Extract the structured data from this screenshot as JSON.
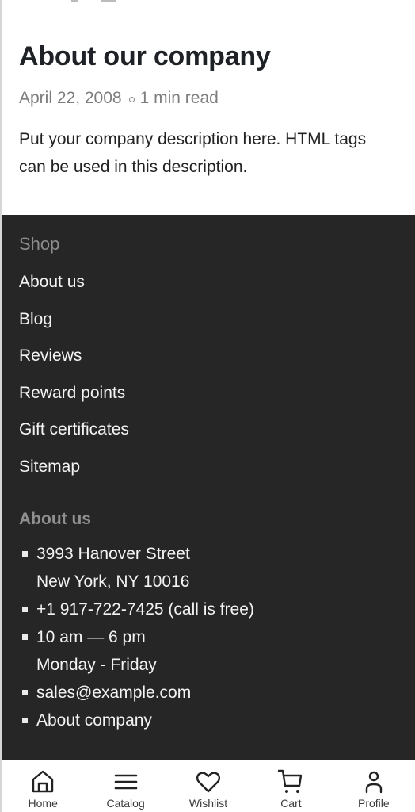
{
  "article": {
    "title": "About our company",
    "date": "April 22, 2008",
    "read_time": "1 min read",
    "body": "Put your company description here. HTML tags can be used in this description."
  },
  "footer": {
    "shop_heading": "Shop",
    "shop_links": [
      {
        "label": "About us"
      },
      {
        "label": "Blog"
      },
      {
        "label": "Reviews"
      },
      {
        "label": "Reward points"
      },
      {
        "label": "Gift certificates"
      },
      {
        "label": "Sitemap"
      }
    ],
    "about_heading": "About us",
    "contacts": {
      "address_line1": "3993 Hanover Street",
      "address_line2": "New York, NY 10016",
      "phone": "+1 917-722-7425 (call is free)",
      "hours_line1": "10 am — 6 pm",
      "hours_line2": "Monday - Friday",
      "email": "sales@example.com",
      "about_link": "About company"
    }
  },
  "bottom_nav": {
    "items": [
      {
        "label": "Home",
        "icon": "home-icon"
      },
      {
        "label": "Catalog",
        "icon": "menu-icon"
      },
      {
        "label": "Wishlist",
        "icon": "heart-icon"
      },
      {
        "label": "Cart",
        "icon": "cart-icon"
      },
      {
        "label": "Profile",
        "icon": "user-icon"
      }
    ]
  }
}
